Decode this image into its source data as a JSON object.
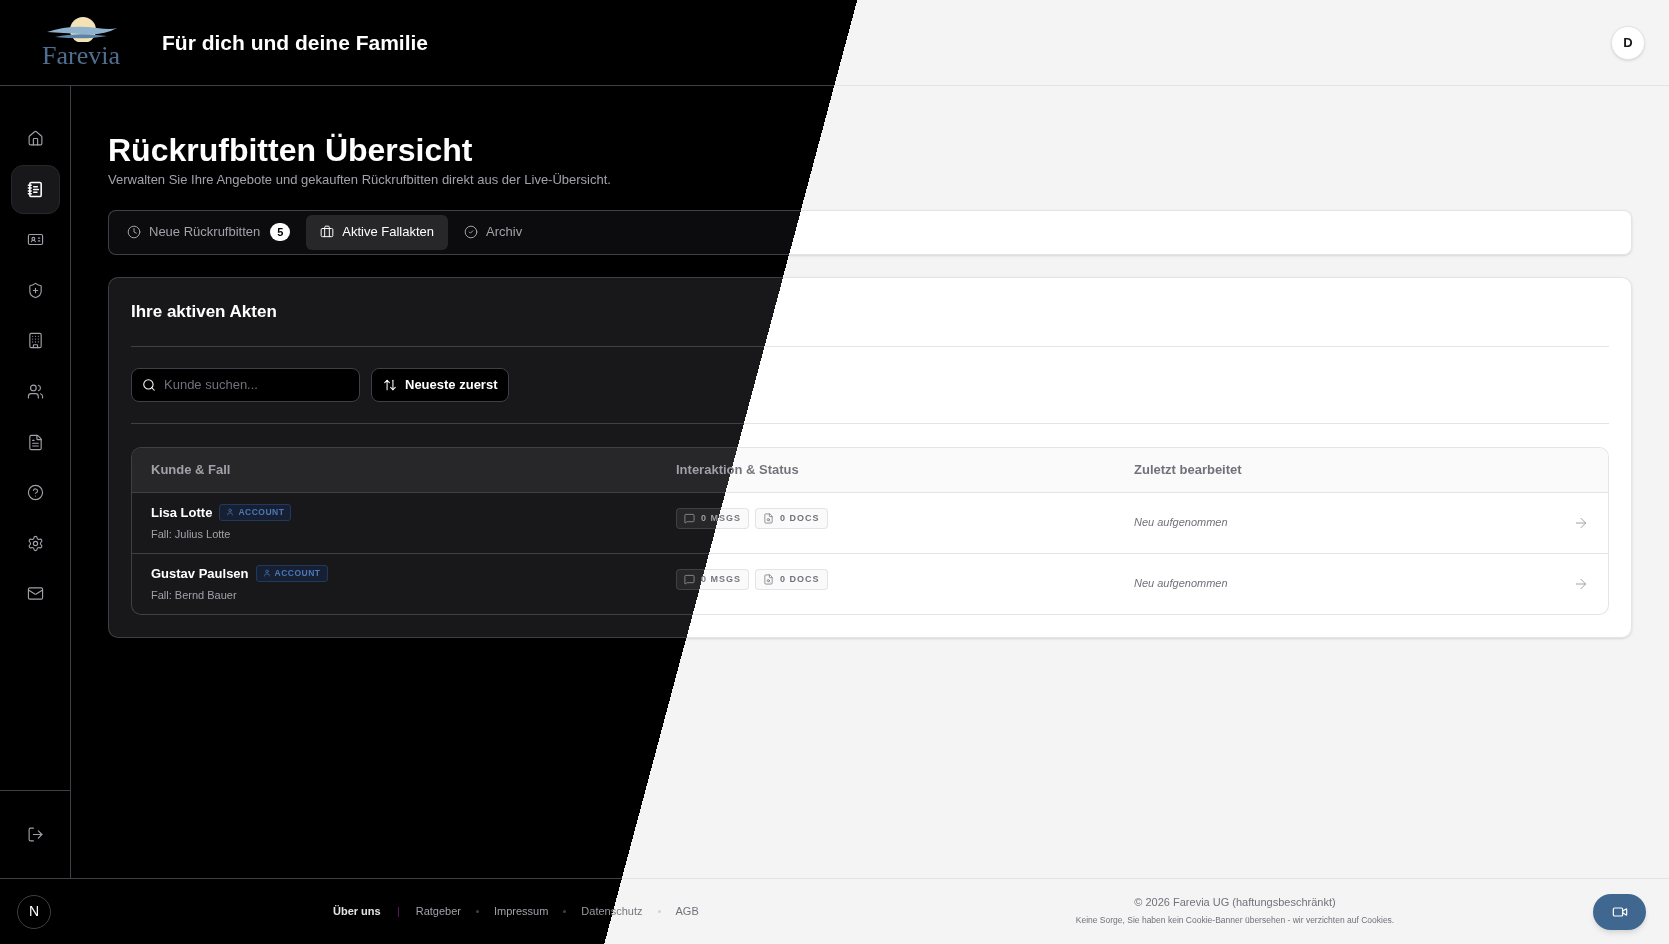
{
  "header": {
    "logo": "Farevia",
    "tagline": "Für dich und deine Familie",
    "avatar": "D"
  },
  "sidebar": {
    "items": [
      {
        "selected": false
      },
      {
        "selected": true
      },
      {
        "selected": false
      },
      {
        "selected": false
      },
      {
        "selected": false
      },
      {
        "selected": false
      },
      {
        "selected": false
      },
      {
        "selected": false
      },
      {
        "selected": false
      },
      {
        "selected": false
      }
    ]
  },
  "page": {
    "title": "Rückrufbitten Übersicht",
    "subtitle": "Verwalten Sie Ihre Angebote und gekauften Rückrufbitten direkt aus der Live-Übersicht."
  },
  "tabs": [
    {
      "label": "Neue Rückrufbitten",
      "count": "5",
      "selected": false
    },
    {
      "label": "Aktive Fallakten",
      "selected": true
    },
    {
      "label": "Archiv",
      "selected": false
    }
  ],
  "card": {
    "title": "Ihre aktiven Akten",
    "search": {
      "placeholder": "Kunde suchen..."
    },
    "sort_button": "Neueste zuerst",
    "table": {
      "columns": [
        "Kunde & Fall",
        "Interaktion & Status",
        "Zuletzt bearbeitet"
      ],
      "rows": [
        {
          "name": "Lisa Lotte",
          "badge": "ACCOUNT",
          "case": "Fall: Julius Lotte",
          "messages": "0 MSGS",
          "documents": "0 DOCS",
          "last_edited": "Neu aufgenommen"
        },
        {
          "name": "Gustav Paulsen",
          "badge": "ACCOUNT",
          "case": "Fall: Bernd Bauer",
          "messages": "0 MSGS",
          "documents": "0 DOCS",
          "last_edited": "Neu aufgenommen"
        }
      ]
    }
  },
  "footer": {
    "dev_badge": "N",
    "links": [
      {
        "label": "Über uns",
        "selected": true
      },
      {
        "label": "Ratgeber",
        "selected": false
      },
      {
        "label": "Impressum",
        "selected": false
      },
      {
        "label": "Datenschutz",
        "selected": false
      },
      {
        "label": "AGB",
        "selected": false
      }
    ],
    "copyright": "© 2026 Farevia UG (haftungsbeschränkt)",
    "note": "Keine Sorge, Sie haben kein Cookie-Banner übersehen - wir verzichten auf Cookies."
  }
}
